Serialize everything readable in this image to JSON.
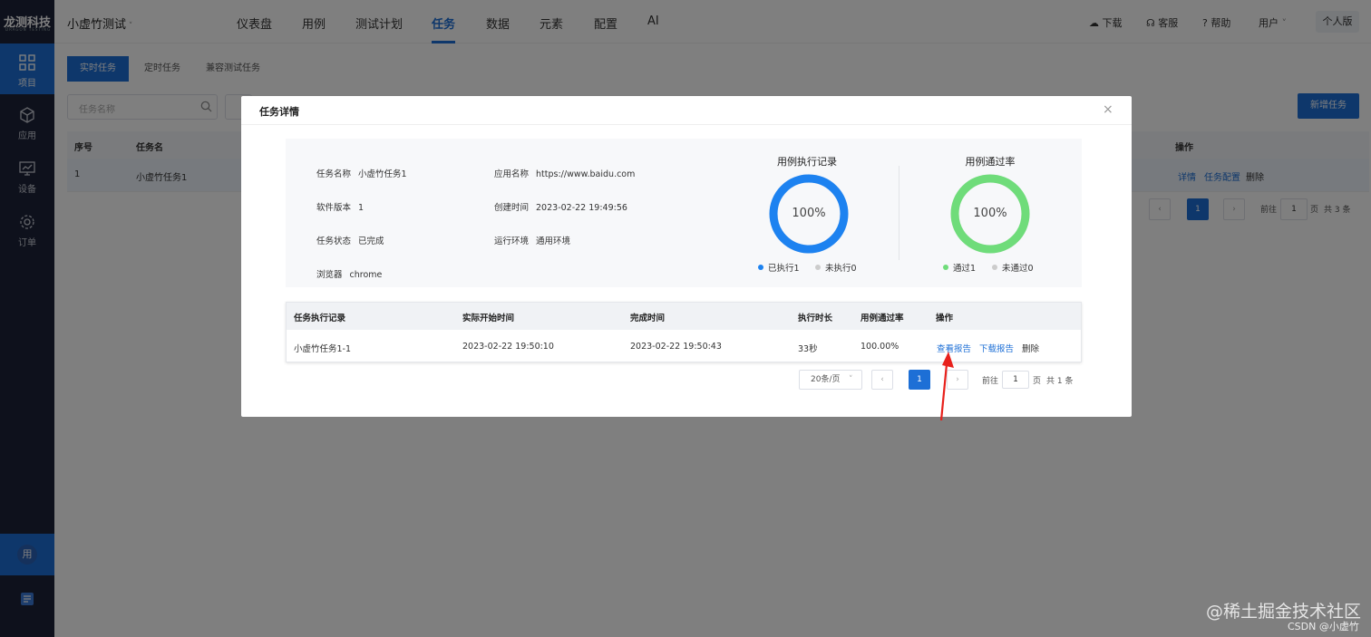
{
  "app": {
    "logo_main": "龙测科技",
    "logo_sub": "DRAGON TESTING",
    "project": "小虚竹测试",
    "nav": [
      "仪表盘",
      "用例",
      "测试计划",
      "任务",
      "数据",
      "元素",
      "配置",
      "AI"
    ],
    "nav_active": "任务",
    "tools": {
      "download": "下载",
      "service": "客服",
      "help": "帮助",
      "user": "用户",
      "personal": "个人版"
    }
  },
  "sidebar": {
    "items": [
      {
        "label": "项目",
        "icon": "grid-icon"
      },
      {
        "label": "应用",
        "icon": "cube-icon"
      },
      {
        "label": "设备",
        "icon": "monitor-icon"
      },
      {
        "label": "订单",
        "icon": "gear-icon"
      }
    ],
    "bottom": [
      {
        "label": "用"
      },
      {
        "label": "document-icon"
      }
    ]
  },
  "page": {
    "tabs": [
      "实时任务",
      "定时任务",
      "兼容测试任务"
    ],
    "search_placeholder": "任务名称",
    "new_task": "新增任务",
    "table_headers": {
      "index": "序号",
      "name": "任务名",
      "ops": "操作"
    },
    "row": {
      "index": "1",
      "name": "小虚竹任务1",
      "ops": [
        "详情",
        "任务配置",
        "删除"
      ]
    },
    "pager": {
      "current": "1",
      "goto": "前往",
      "goto_val": "1",
      "page_unit": "页",
      "total": "共 3 条"
    }
  },
  "modal": {
    "title": "任务详情",
    "close": "×",
    "info": {
      "task_name": {
        "k": "任务名称",
        "v": "小虚竹任务1"
      },
      "software_version": {
        "k": "软件版本",
        "v": "1"
      },
      "task_status": {
        "k": "任务状态",
        "v": "已完成"
      },
      "browser": {
        "k": "浏览器",
        "v": "chrome"
      },
      "app_name": {
        "k": "应用名称",
        "v": "https://www.baidu.com"
      },
      "created_at": {
        "k": "创建时间",
        "v": "2023-02-22 19:49:56"
      },
      "run_env": {
        "k": "运行环境",
        "v": "通用环境"
      }
    },
    "charts": [
      {
        "title": "用例执行记录",
        "center": "100%",
        "color": "#1d82f0",
        "fraction": 1.0,
        "legend": [
          {
            "label": "已执行1",
            "color": "#1d82f0"
          },
          {
            "label": "未执行0",
            "color": "#cccccc"
          }
        ]
      },
      {
        "title": "用例通过率",
        "center": "100%",
        "color": "#6fdc7a",
        "fraction": 1.0,
        "legend": [
          {
            "label": "通过1",
            "color": "#6fdc7a"
          },
          {
            "label": "未通过0",
            "color": "#cccccc"
          }
        ]
      }
    ],
    "records": {
      "headers": [
        "任务执行记录",
        "实际开始时间",
        "完成时间",
        "执行时长",
        "用例通过率",
        "操作"
      ],
      "row": {
        "name": "小虚竹任务1-1",
        "start": "2023-02-22 19:50:10",
        "end": "2023-02-22 19:50:43",
        "duration": "33秒",
        "pass_rate": "100.00%",
        "ops": [
          "查看报告",
          "下载报告",
          "删除"
        ]
      }
    },
    "pager": {
      "page_size": "20条/页",
      "current": "1",
      "goto": "前往",
      "goto_val": "1",
      "page_unit": "页",
      "total": "共 1 条"
    }
  },
  "watermark": {
    "main": "@稀土掘金技术社区",
    "sub": "CSDN @小虚竹"
  }
}
